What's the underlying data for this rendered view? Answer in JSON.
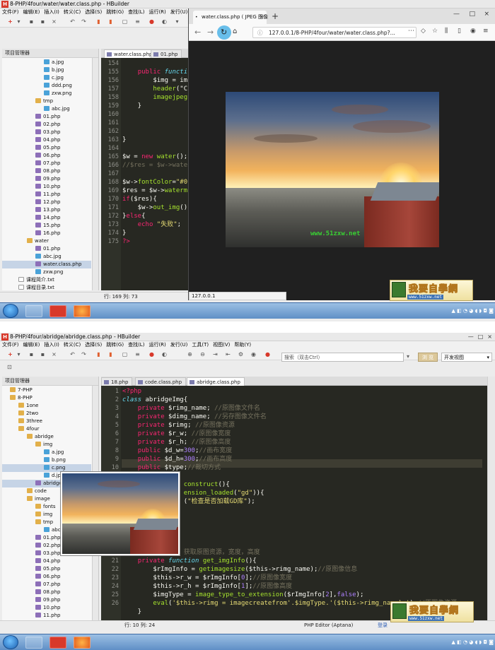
{
  "top": {
    "window_title": "8-PHP/4four/water/water.class.php - HBuilder",
    "menu": [
      "文件(F)",
      "编辑(E)",
      "插入(I)",
      "转义(C)",
      "选择(S)",
      "跳转(G)",
      "查找(L)",
      "运行(R)",
      "发行(U)"
    ],
    "tree_header": "项目管理器",
    "tree": [
      {
        "label": "a.jpg",
        "kind": "img",
        "indent": 62
      },
      {
        "label": "b.jpg",
        "kind": "img",
        "indent": 62
      },
      {
        "label": "c.jpg",
        "kind": "img",
        "indent": 62
      },
      {
        "label": "ddd.png",
        "kind": "img",
        "indent": 62
      },
      {
        "label": "zxw.png",
        "kind": "img",
        "indent": 62
      },
      {
        "label": "tmp",
        "kind": "folder",
        "indent": 50
      },
      {
        "label": "abc.jpg",
        "kind": "img",
        "indent": 62
      },
      {
        "label": "01.php",
        "kind": "php",
        "indent": 50
      },
      {
        "label": "02.php",
        "kind": "php",
        "indent": 50
      },
      {
        "label": "03.php",
        "kind": "php",
        "indent": 50
      },
      {
        "label": "04.php",
        "kind": "php",
        "indent": 50
      },
      {
        "label": "05.php",
        "kind": "php",
        "indent": 50
      },
      {
        "label": "06.php",
        "kind": "php",
        "indent": 50
      },
      {
        "label": "07.php",
        "kind": "php",
        "indent": 50
      },
      {
        "label": "08.php",
        "kind": "php",
        "indent": 50
      },
      {
        "label": "09.php",
        "kind": "php",
        "indent": 50
      },
      {
        "label": "10.php",
        "kind": "php",
        "indent": 50
      },
      {
        "label": "11.php",
        "kind": "php",
        "indent": 50
      },
      {
        "label": "12.php",
        "kind": "php",
        "indent": 50
      },
      {
        "label": "13.php",
        "kind": "php",
        "indent": 50
      },
      {
        "label": "14.php",
        "kind": "php",
        "indent": 50
      },
      {
        "label": "15.php",
        "kind": "php",
        "indent": 50
      },
      {
        "label": "16.php",
        "kind": "php",
        "indent": 50
      },
      {
        "label": "water",
        "kind": "folder",
        "indent": 38
      },
      {
        "label": "01.php",
        "kind": "php",
        "indent": 50
      },
      {
        "label": "abc.jpg",
        "kind": "img",
        "indent": 50
      },
      {
        "label": "water.class.php",
        "kind": "php",
        "indent": 50,
        "selected": true
      },
      {
        "label": "zxw.png",
        "kind": "img",
        "indent": 50
      },
      {
        "label": "课程简介.txt",
        "kind": "txt",
        "indent": 26
      },
      {
        "label": "课程目录.txt",
        "kind": "txt",
        "indent": 26
      }
    ],
    "tabs": [
      "water.class.php",
      "01.php"
    ],
    "gutter": [
      "154",
      "155",
      "156",
      "157",
      "158",
      "159",
      "160",
      "161",
      "162",
      "163",
      "164",
      "165",
      "166",
      "167",
      "168",
      "169",
      "170",
      "171",
      "172",
      "173",
      "174",
      "175"
    ],
    "code": [
      "",
      "    <k>public</k> <t>functi</t>",
      "        $img = im",
      "        <f>header</f>(\"C",
      "        <f>imagejpeg</f>",
      "    }",
      "",
      "",
      "",
      "}",
      "",
      "$w = <k>new</k> <f>water</f>();",
      "<c>//$res = $w->wate</c>",
      "",
      "$w-><f>fontColor</f>=<s>\"#0</s>",
      "$res = $w-><f>waterm</f>",
      "<k>if</k>($res){",
      "    $w-><f>out_img</f>()",
      "}<k>else</k>{",
      "    <k>echo</k> <s>\"失败\"</s>;",
      "}",
      "<k>?></k>"
    ],
    "status": "行: 169 列: 73",
    "browser": {
      "tab_title": "water.class.php ( JPEG 图像",
      "url": "127.0.0.1/8-PHP/4four/water/water.class.php?...",
      "status": "127.0.0.1"
    },
    "image_watermark": "www.51zxw.net"
  },
  "bottom": {
    "window_title": "8-PHP/4four/abridge/abridge.class.php - HBuilder",
    "menu": [
      "文件(F)",
      "编辑(E)",
      "插入(I)",
      "转义(C)",
      "选择(S)",
      "跳转(G)",
      "查找(L)",
      "运行(R)",
      "发行(U)",
      "工具(T)",
      "视图(V)",
      "帮助(Y)"
    ],
    "search_placeholder": "搜索（双击Ctrl）",
    "compare_button": "浏 览",
    "view_select": "开发视图",
    "tree_header": "项目管理器",
    "tree": [
      {
        "label": "7-PHP",
        "kind": "folder",
        "indent": 14
      },
      {
        "label": "8-PHP",
        "kind": "folder",
        "indent": 14
      },
      {
        "label": "1one",
        "kind": "folder",
        "indent": 26
      },
      {
        "label": "2two",
        "kind": "folder",
        "indent": 26
      },
      {
        "label": "3three",
        "kind": "folder",
        "indent": 26
      },
      {
        "label": "4four",
        "kind": "folder",
        "indent": 26
      },
      {
        "label": "abridge",
        "kind": "folder",
        "indent": 38
      },
      {
        "label": "img",
        "kind": "folder",
        "indent": 50
      },
      {
        "label": "a.jpg",
        "kind": "img",
        "indent": 62
      },
      {
        "label": "b.png",
        "kind": "img",
        "indent": 62
      },
      {
        "label": "c.png",
        "kind": "img",
        "indent": 62,
        "selected": true
      },
      {
        "label": "d.jp",
        "kind": "img",
        "indent": 62
      },
      {
        "label": "abridge",
        "kind": "php",
        "indent": 50,
        "selected": true
      },
      {
        "label": "code",
        "kind": "folder",
        "indent": 38
      },
      {
        "label": "image",
        "kind": "folder",
        "indent": 38
      },
      {
        "label": "fonts",
        "kind": "folder",
        "indent": 50
      },
      {
        "label": "img",
        "kind": "folder",
        "indent": 50
      },
      {
        "label": "tmp",
        "kind": "folder",
        "indent": 50
      },
      {
        "label": "abc.j",
        "kind": "img",
        "indent": 62
      },
      {
        "label": "01.php",
        "kind": "php",
        "indent": 50
      },
      {
        "label": "02.php",
        "kind": "php",
        "indent": 50
      },
      {
        "label": "03.php",
        "kind": "php",
        "indent": 50
      },
      {
        "label": "04.php",
        "kind": "php",
        "indent": 50
      },
      {
        "label": "05.php",
        "kind": "php",
        "indent": 50
      },
      {
        "label": "06.php",
        "kind": "php",
        "indent": 50
      },
      {
        "label": "07.php",
        "kind": "php",
        "indent": 50
      },
      {
        "label": "08.php",
        "kind": "php",
        "indent": 50
      },
      {
        "label": "09.php",
        "kind": "php",
        "indent": 50
      },
      {
        "label": "10.php",
        "kind": "php",
        "indent": 50
      },
      {
        "label": "11.php",
        "kind": "php",
        "indent": 50
      }
    ],
    "tabs": [
      "18.php",
      "code.class.php",
      "abridge.class.php"
    ],
    "gutter": [
      "1",
      "2",
      "3",
      "4",
      "5",
      "6",
      "7",
      "8",
      "9",
      "10",
      "11",
      "12",
      "13",
      "14",
      "15",
      "16",
      "17",
      "18",
      "19",
      "20",
      "21",
      "22",
      "23",
      "24",
      "25",
      "26"
    ],
    "code": [
      "<k><?php</k>",
      "<t>class</t> abridgeImg{",
      "    <k>private</k> $rimg_name; <c>//原图像文件名</c>",
      "    <k>private</k> $dimg_name; <c>//另存图像文件名</c>",
      "    <k>private</k> $rimg; <c>//原图像资源</c>",
      "    <k>private</k> $r_w; <c>//原图像宽度</c>",
      "    <k>private</k> $r_h; <c>//原图像高度</c>",
      "    <k>public</k> $d_w=<n>300</n>;<c>//画布宽度</c>",
      "    <k>public</k> $d_h=<n>300</n>;<c>//画布高度</c>",
      "    <k>public</k> $type;<c>//裁切方式</c>",
      "",
      "                <f>construct</f>(){",
      "                <f>ension_loaded</f>(<s>\"gd\"</s>)){",
      "                (<s>\"检查是否加载GD库\"</s>);",
      "",
      "",
      "",
      "",
      "",
      "                <c>获取原图资源，宽度，高度</c>",
      "    <k>private</k> <t>function</t> <f>get_imgInfo</f>(){",
      "        $rImgInfo = <f>getimagesize</f>($this->rimg_name);<c>//原图像信息</c>",
      "        $this->r_w = $rImgInfo[<n>0</n>];<c>//原图像宽度</c>",
      "        $this->r_h = $rImgInfo[<n>1</n>];<c>//原图像高度</c>",
      "        $imgType = <f>image_type_to_extension</f>($rImgInfo[<n>2</n>],<n>false</n>);",
      "        <f>eval</f>(<s>'$this->rimg = imagecreatefrom'.$imgType.'($this->rimg_name);'</s>);<c>//原图像资源</c>",
      "    }"
    ],
    "status": "行: 10 列: 24",
    "editor_mode": "PHP Editor (Aptana)",
    "login": "登录"
  },
  "logo": {
    "text": "我要自學網",
    "url": "www.51zxw.net"
  },
  "colors": {
    "editor_bg": "#272822",
    "keyword": "#f92672",
    "function": "#a6e22e",
    "string": "#e6db74",
    "comment": "#75715e",
    "number": "#ae81ff",
    "watermark": "#39d033"
  }
}
